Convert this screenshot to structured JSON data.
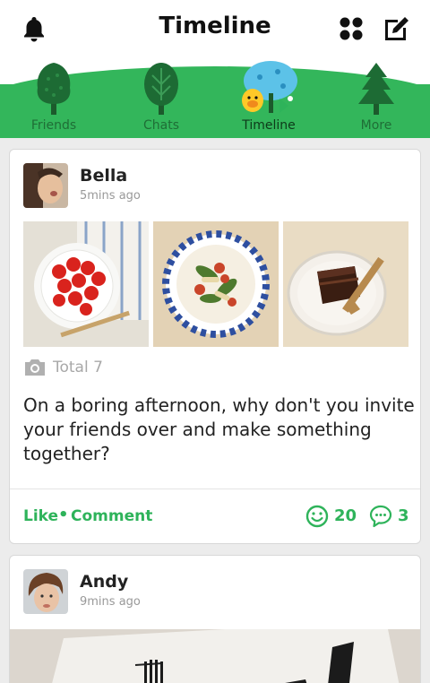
{
  "header": {
    "title": "Timeline",
    "icons": [
      "bell-icon",
      "apps-grid-icon",
      "compose-icon"
    ]
  },
  "tabs": [
    {
      "label": "Friends",
      "active": false
    },
    {
      "label": "Chats",
      "active": false
    },
    {
      "label": "Timeline",
      "active": true
    },
    {
      "label": "More",
      "active": false
    }
  ],
  "posts": [
    {
      "author": "Bella",
      "time": "5mins ago",
      "total": "Total 7",
      "text": "On a boring afternoon, why don't you invite your friends over and make something together?",
      "like_label": "Like",
      "separator": "•",
      "comment_label": "Comment",
      "like_count": "20",
      "comment_count": "3"
    },
    {
      "author": "Andy",
      "time": "9mins ago"
    }
  ],
  "colors": {
    "accent": "#2eb35a",
    "tab_green": "#33b65b",
    "background": "#ececec"
  }
}
